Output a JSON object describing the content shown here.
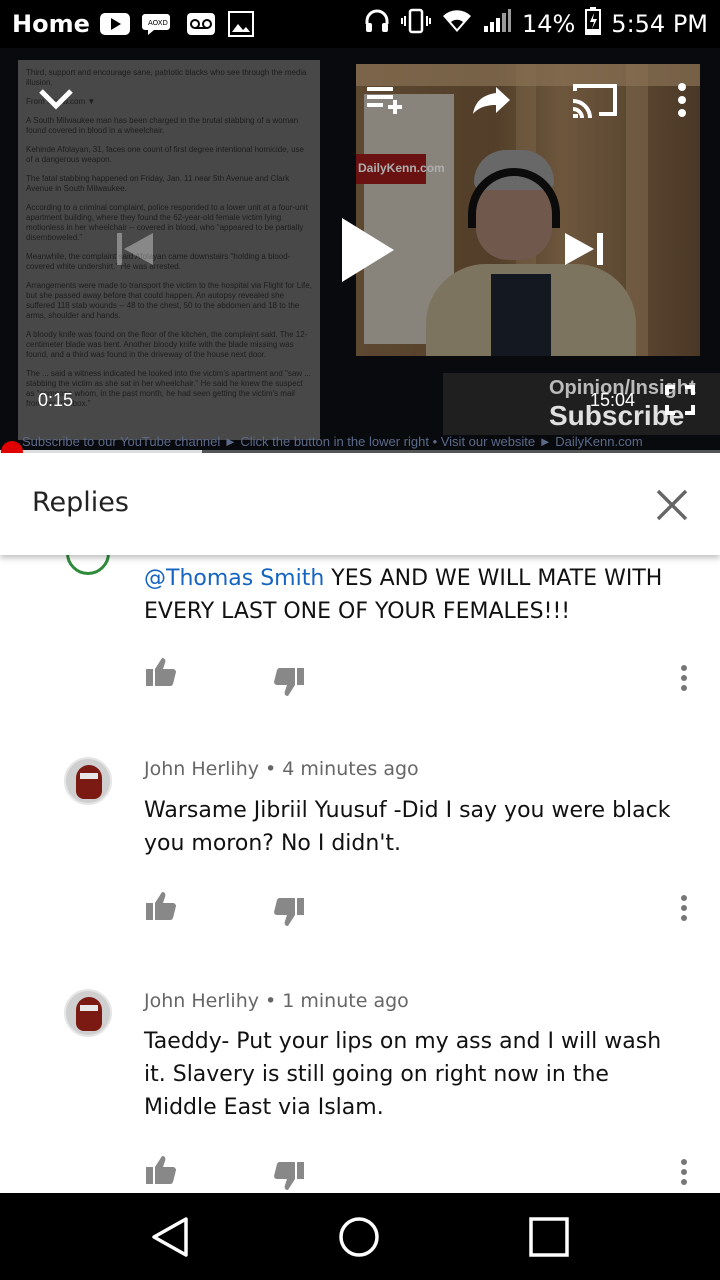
{
  "status_bar": {
    "home_label": "Home",
    "battery": "14%",
    "time": "5:54 PM",
    "icons": [
      "youtube-icon",
      "chat-icon",
      "voicemail-icon",
      "image-icon",
      "headphones-icon",
      "vibrate-icon",
      "wifi-icon",
      "signal-icon",
      "battery-icon"
    ]
  },
  "player": {
    "current_time": "0:15",
    "duration": "15:04",
    "progress_fraction": 0.28,
    "subscribe_overlay": {
      "line1": "Opinion/Insight",
      "line2": "Subscribe"
    },
    "cam_sign": "DailyKenn.com",
    "ticker": "Subscribe to our YouTube channel ► Click the button in the lower right    •    Visit our website ► DailyKenn.com",
    "article_lines": [
      "Third, support and encourage sane, patriotic blacks who see through the media illusion.",
      "From ...now.com ▼",
      "A South Milwaukee man has been charged in the brutal stabbing of a woman found covered in blood in a wheelchair.",
      "Kehinde Afolayan, 31, faces one count of first degree intentional homicide, use of a dangerous weapon.",
      "The fatal stabbing happened on Friday, Jan. 11 near 5th Avenue and Clark Avenue in South Milwaukee.",
      "According to a criminal complaint, police responded to a lower unit at a four-unit apartment building, where they found the 62-year-old female victim lying motionless in her wheelchair -- covered in blood, who \"appeared to be partially disemboweled.\"",
      "Meanwhile, the complaint said Afolayan came downstairs \"holding a blood-covered white undershirt.\" He was arrested.",
      "Arrangements were made to transport the victim to the hospital via Flight for Life, but she passed away before that could happen. An autopsy revealed she suffered 118 stab wounds -- 48 to the chest, 50 to the abdomen and 18 to the arms, shoulder and hands.",
      "A bloody knife was found on the floor of the kitchen, the complaint said. The 12-centimeter blade was bent. Another bloody knife with the blade missing was found, and a third was found in the driveway of the house next door.",
      "The ... said a witness indicated he looked into the victim's apartment and \"saw ... stabbing the victim as she sat in her wheelchair.\" He said he knew the suspect as \"someone whom, in the past month, he had seen getting the victim's mail from her mailbox.\""
    ]
  },
  "panel": {
    "title": "Replies",
    "comments": [
      {
        "author": "",
        "age": "",
        "mention": "@Thomas Smith",
        "text": " YES AND WE WILL MATE WITH EVERY LAST ONE OF YOUR FEMALES!!!"
      },
      {
        "author": "John Herlihy",
        "age": "4 minutes ago",
        "meta": "John Herlihy • 4 minutes ago",
        "text": "Warsame Jibriil Yuusuf -Did I say you were black you moron?  No I didn't."
      },
      {
        "author": "John Herlihy",
        "age": "1 minute ago",
        "meta": "John Herlihy • 1 minute ago",
        "text": "Taeddy- Put your lips on my ass and I will wash it. Slavery is still going on right now in the Middle East via Islam."
      }
    ]
  },
  "colors": {
    "accent_red": "#e00000",
    "mention_blue": "#1565c0"
  }
}
